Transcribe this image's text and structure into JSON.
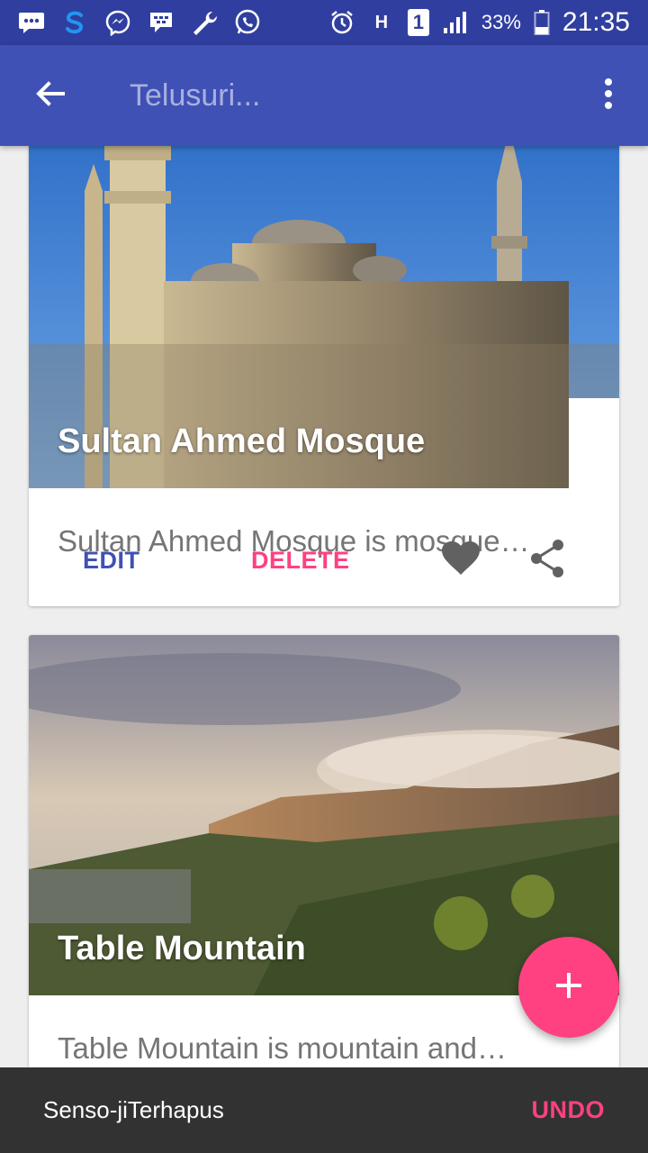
{
  "status_bar": {
    "left_icons": [
      "bbm-icon",
      "s-app-icon",
      "messenger-icon",
      "blackberry-icon",
      "wrench-icon",
      "whatsapp-icon"
    ],
    "right_icons": [
      "alarm-icon",
      "hplus-signal-icon",
      "sim-1-icon",
      "signal-bars-icon",
      "battery-icon"
    ],
    "network": "H",
    "sim": "1",
    "battery": "33%",
    "time": "21:35"
  },
  "app_bar": {
    "search_placeholder": "Telusuri...",
    "back_icon": "arrow-back-icon",
    "more_icon": "more-vert-icon"
  },
  "cards": [
    {
      "title": "Sultan Ahmed Mosque",
      "description": "Sultan Ahmed Mosque is mosque…",
      "edit_label": "EDIT",
      "delete_label": "DELETE"
    },
    {
      "title": "Table Mountain",
      "description": "Table Mountain is mountain and…"
    }
  ],
  "snackbar": {
    "message": "Senso-jiTerhapus",
    "action": "UNDO"
  },
  "colors": {
    "primary": "#3f51b5",
    "primary_dark": "#303f9f",
    "accent": "#ff4081",
    "snackbar_bg": "#323232",
    "background": "#eeeeee"
  }
}
